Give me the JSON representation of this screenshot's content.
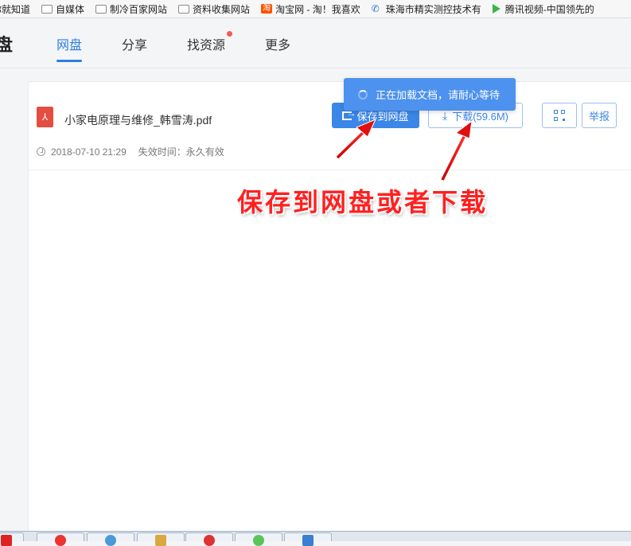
{
  "bookmarks": [
    {
      "label": "你就知道",
      "icon": "none"
    },
    {
      "label": "自媒体",
      "icon": "folder-icon"
    },
    {
      "label": "制冷百家网站",
      "icon": "folder-icon"
    },
    {
      "label": "资料收集网站",
      "icon": "folder-icon"
    },
    {
      "label": "淘宝网 - 淘！我喜欢",
      "icon": "taobao-icon",
      "icon_text": "淘"
    },
    {
      "label": "珠海市精实测控技术有",
      "icon": "phone-icon"
    },
    {
      "label": "腾讯视频-中国领先的",
      "icon": "tencent-video-icon"
    }
  ],
  "header": {
    "logo_char": "盘",
    "nav": [
      {
        "label": "网盘",
        "active": true
      },
      {
        "label": "分享",
        "active": false
      },
      {
        "label": "找资源",
        "active": false,
        "badge": true
      },
      {
        "label": "更多",
        "active": false
      }
    ]
  },
  "file": {
    "icon_text": "⅄",
    "name": "小家电原理与维修_韩雪涛.pdf",
    "date": "2018-07-10 21:29",
    "expiry": "失效时间：永久有效"
  },
  "buttons": {
    "save": "保存到网盘",
    "download": "下载(59.6M)",
    "report": "举报"
  },
  "toast": {
    "text": "正在加载文档，请耐心等待"
  },
  "annotation": {
    "text": "保存到网盘或者下载"
  },
  "colors": {
    "accent": "#2f7de1",
    "annotation": "#ff2020",
    "toast": "#4d92ee"
  }
}
